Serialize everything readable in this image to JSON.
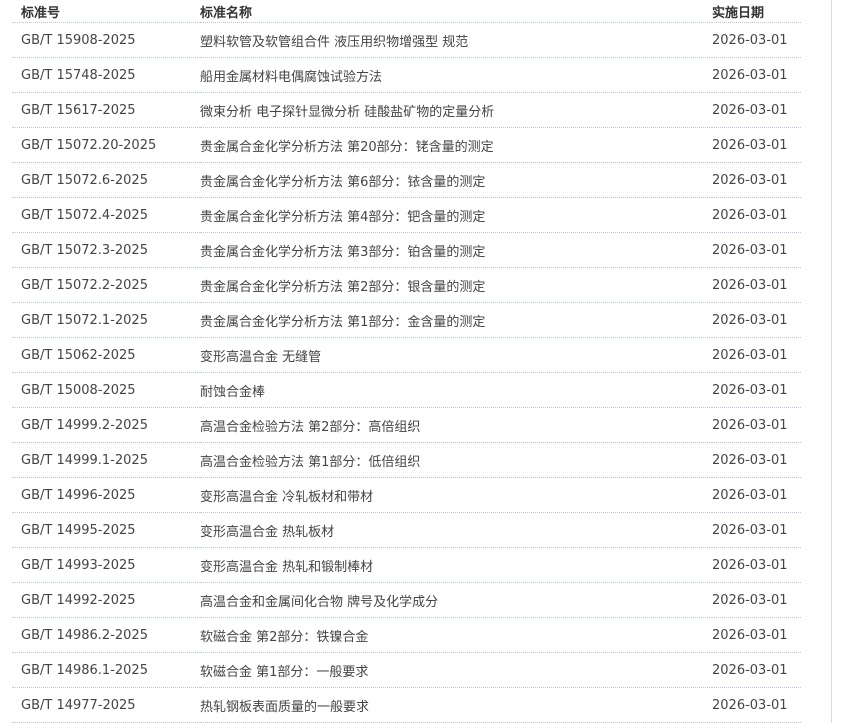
{
  "table": {
    "headers": {
      "code": "标准号",
      "name": "标准名称",
      "date": "实施日期"
    },
    "rows": [
      {
        "code": "GB/T 15908-2025",
        "name": "塑料软管及软管组合件 液压用织物增强型 规范",
        "date": "2026-03-01"
      },
      {
        "code": "GB/T 15748-2025",
        "name": "船用金属材料电偶腐蚀试验方法",
        "date": "2026-03-01"
      },
      {
        "code": "GB/T 15617-2025",
        "name": "微束分析 电子探针显微分析 硅酸盐矿物的定量分析",
        "date": "2026-03-01"
      },
      {
        "code": "GB/T 15072.20-2025",
        "name": "贵金属合金化学分析方法 第20部分：铑含量的测定",
        "date": "2026-03-01"
      },
      {
        "code": "GB/T 15072.6-2025",
        "name": "贵金属合金化学分析方法 第6部分：铱含量的测定",
        "date": "2026-03-01"
      },
      {
        "code": "GB/T 15072.4-2025",
        "name": "贵金属合金化学分析方法 第4部分：钯含量的测定",
        "date": "2026-03-01"
      },
      {
        "code": "GB/T 15072.3-2025",
        "name": "贵金属合金化学分析方法 第3部分：铂含量的测定",
        "date": "2026-03-01"
      },
      {
        "code": "GB/T 15072.2-2025",
        "name": "贵金属合金化学分析方法 第2部分：银含量的测定",
        "date": "2026-03-01"
      },
      {
        "code": "GB/T 15072.1-2025",
        "name": "贵金属合金化学分析方法 第1部分：金含量的测定",
        "date": "2026-03-01"
      },
      {
        "code": "GB/T 15062-2025",
        "name": "变形高温合金 无缝管",
        "date": "2026-03-01"
      },
      {
        "code": "GB/T 15008-2025",
        "name": "耐蚀合金棒",
        "date": "2026-03-01"
      },
      {
        "code": "GB/T 14999.2-2025",
        "name": "高温合金检验方法 第2部分：高倍组织",
        "date": "2026-03-01"
      },
      {
        "code": "GB/T 14999.1-2025",
        "name": "高温合金检验方法 第1部分：低倍组织",
        "date": "2026-03-01"
      },
      {
        "code": "GB/T 14996-2025",
        "name": "变形高温合金 冷轧板材和带材",
        "date": "2026-03-01"
      },
      {
        "code": "GB/T 14995-2025",
        "name": "变形高温合金 热轧板材",
        "date": "2026-03-01"
      },
      {
        "code": "GB/T 14993-2025",
        "name": "变形高温合金 热轧和锻制棒材",
        "date": "2026-03-01"
      },
      {
        "code": "GB/T 14992-2025",
        "name": "高温合金和金属间化合物 牌号及化学成分",
        "date": "2026-03-01"
      },
      {
        "code": "GB/T 14986.2-2025",
        "name": "软磁合金 第2部分：铁镍合金",
        "date": "2026-03-01"
      },
      {
        "code": "GB/T 14986.1-2025",
        "name": "软磁合金 第1部分：一般要求",
        "date": "2026-03-01"
      },
      {
        "code": "GB/T 14977-2025",
        "name": "热轧钢板表面质量的一般要求",
        "date": "2026-03-01"
      }
    ]
  }
}
